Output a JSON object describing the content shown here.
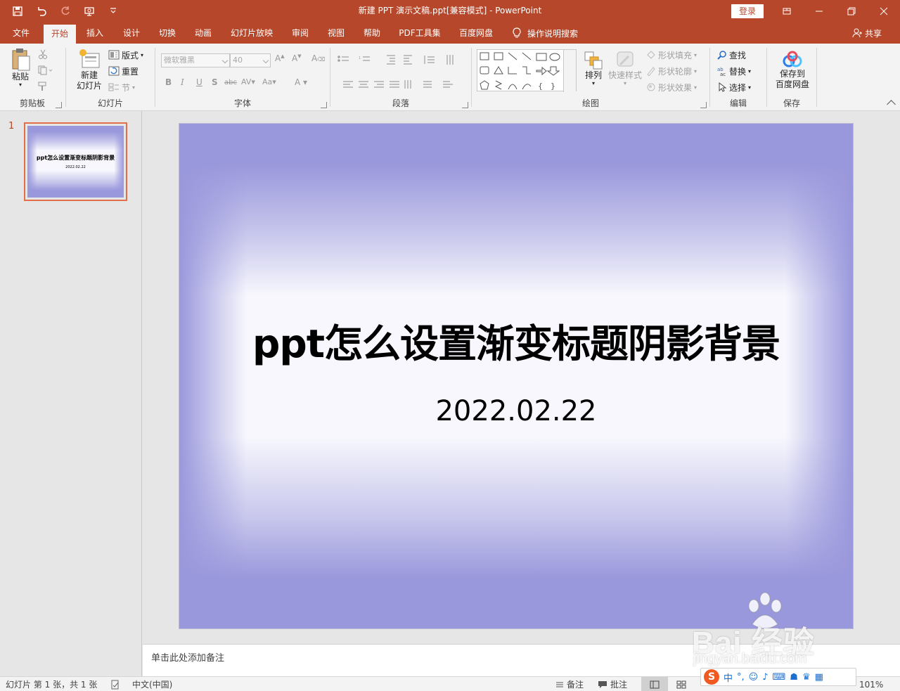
{
  "window": {
    "title": "新建 PPT 演示文稿.ppt[兼容模式]  -  PowerPoint",
    "login": "登录"
  },
  "tabs": [
    {
      "label": "文件"
    },
    {
      "label": "开始"
    },
    {
      "label": "插入"
    },
    {
      "label": "设计"
    },
    {
      "label": "切换"
    },
    {
      "label": "动画"
    },
    {
      "label": "幻灯片放映"
    },
    {
      "label": "审阅"
    },
    {
      "label": "视图"
    },
    {
      "label": "帮助"
    },
    {
      "label": "PDF工具集"
    },
    {
      "label": "百度网盘"
    }
  ],
  "active_tab": "开始",
  "tell_me": "操作说明搜索",
  "share": "共享",
  "ribbon": {
    "clipboard": {
      "label": "剪贴板",
      "paste": "粘贴"
    },
    "slides": {
      "label": "幻灯片",
      "new_slide_1": "新建",
      "new_slide_2": "幻灯片",
      "layout": "版式",
      "reset": "重置",
      "section": "节"
    },
    "font": {
      "label": "字体",
      "font_name": "微软雅黑",
      "font_size": "40"
    },
    "paragraph": {
      "label": "段落"
    },
    "drawing": {
      "label": "绘图",
      "arrange": "排列",
      "quick_styles": "快速样式",
      "shape_fill": "形状填充",
      "shape_outline": "形状轮廓",
      "shape_effects": "形状效果"
    },
    "editing": {
      "label": "编辑",
      "find": "查找",
      "replace": "替换",
      "select": "选择"
    },
    "save": {
      "label": "保存",
      "save_to_1": "保存到",
      "save_to_2": "百度网盘"
    }
  },
  "thumbnails": [
    {
      "number": "1",
      "title": "ppt怎么设置渐变标题阴影背景",
      "date": "2022.02.22"
    }
  ],
  "slide": {
    "title": "ppt怎么设置渐变标题阴影背景",
    "subtitle": "2022.02.22"
  },
  "notes_placeholder": "单击此处添加备注",
  "status": {
    "slide_info": "幻灯片 第 1 张，共 1 张",
    "language": "中文(中国)",
    "notes": "备注",
    "comments": "批注",
    "zoom": "101%"
  },
  "watermark": {
    "text": "Bai  经验",
    "url": "jingyan.baidu.com"
  },
  "ime": {
    "mode": "中"
  },
  "colors": {
    "accent": "#b7472a",
    "slide_gradient": "#9a98dc",
    "thumb_border": "#e1704a"
  }
}
